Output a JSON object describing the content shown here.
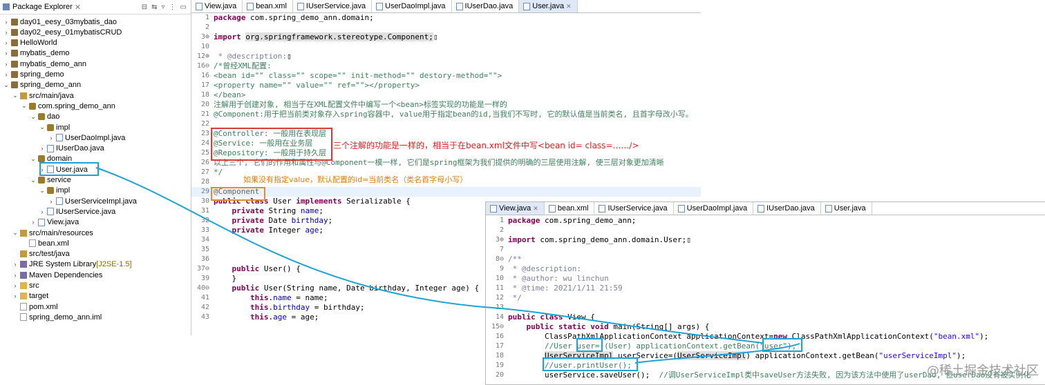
{
  "explorer": {
    "title": "Package Explorer",
    "items": [
      {
        "label": "day01_eesy_03mybatis_dao",
        "depth": 0,
        "arrow": "›",
        "icon": "proj"
      },
      {
        "label": "day02_eesy_01mybatisCRUD",
        "depth": 0,
        "arrow": "›",
        "icon": "proj"
      },
      {
        "label": "HelloWorld",
        "depth": 0,
        "arrow": "›",
        "icon": "proj"
      },
      {
        "label": "mybatis_demo",
        "depth": 0,
        "arrow": "›",
        "icon": "proj"
      },
      {
        "label": "mybatis_demo_ann",
        "depth": 0,
        "arrow": "›",
        "icon": "proj"
      },
      {
        "label": "spring_demo",
        "depth": 0,
        "arrow": "›",
        "icon": "proj"
      },
      {
        "label": "spring_demo_ann",
        "depth": 0,
        "arrow": "⌄",
        "icon": "proj"
      },
      {
        "label": "src/main/java",
        "depth": 1,
        "arrow": "⌄",
        "icon": "src"
      },
      {
        "label": "com.spring_demo_ann",
        "depth": 2,
        "arrow": "⌄",
        "icon": "pkg"
      },
      {
        "label": "dao",
        "depth": 3,
        "arrow": "⌄",
        "icon": "pkg"
      },
      {
        "label": "impl",
        "depth": 4,
        "arrow": "⌄",
        "icon": "pkg"
      },
      {
        "label": "UserDaoImpl.java",
        "depth": 5,
        "arrow": "›",
        "icon": "java"
      },
      {
        "label": "IUserDao.java",
        "depth": 4,
        "arrow": "›",
        "icon": "java"
      },
      {
        "label": "domain",
        "depth": 3,
        "arrow": "⌄",
        "icon": "pkg"
      },
      {
        "label": "User.java",
        "depth": 4,
        "arrow": "›",
        "icon": "java"
      },
      {
        "label": "service",
        "depth": 3,
        "arrow": "⌄",
        "icon": "pkg"
      },
      {
        "label": "impl",
        "depth": 4,
        "arrow": "⌄",
        "icon": "pkg"
      },
      {
        "label": "UserServiceImpl.java",
        "depth": 5,
        "arrow": "›",
        "icon": "java"
      },
      {
        "label": "IUserService.java",
        "depth": 4,
        "arrow": "›",
        "icon": "java"
      },
      {
        "label": "View.java",
        "depth": 3,
        "arrow": "›",
        "icon": "java"
      },
      {
        "label": "src/main/resources",
        "depth": 1,
        "arrow": "⌄",
        "icon": "src"
      },
      {
        "label": "bean.xml",
        "depth": 2,
        "arrow": "",
        "icon": "xml"
      },
      {
        "label": "src/test/java",
        "depth": 1,
        "arrow": "",
        "icon": "src"
      },
      {
        "label": "JRE System Library",
        "badge": "[J2SE-1.5]",
        "depth": 1,
        "arrow": "›",
        "icon": "lib"
      },
      {
        "label": "Maven Dependencies",
        "depth": 1,
        "arrow": "›",
        "icon": "lib"
      },
      {
        "label": "src",
        "depth": 1,
        "arrow": "›",
        "icon": "folder"
      },
      {
        "label": "target",
        "depth": 1,
        "arrow": "›",
        "icon": "folder"
      },
      {
        "label": "pom.xml",
        "depth": 1,
        "arrow": "",
        "icon": "xml"
      },
      {
        "label": "spring_demo_ann.iml",
        "depth": 1,
        "arrow": "",
        "icon": "xml"
      }
    ]
  },
  "editor1": {
    "tabs": [
      "View.java",
      "bean.xml",
      "IUserService.java",
      "UserDaoImpl.java",
      "IUserDao.java",
      "User.java"
    ],
    "active_tab": "User.java",
    "lines": [
      {
        "n": "1",
        "html": "<span class=\"kw\">package</span> com.spring_demo_ann.domain;"
      },
      {
        "n": "2",
        "html": ""
      },
      {
        "n": "3⊕",
        "html": "<span class=\"kw\">import</span> <span style=\"background:#e0e0e0\">org.springframework.stereotype.Component;</span>▯"
      },
      {
        "n": "10",
        "html": ""
      },
      {
        "n": "12⊕",
        "html": "<span class=\"ja\"> * @description:</span>▯"
      },
      {
        "n": "16⊖",
        "html": "<span class=\"cm\">/*曾经XML配置:</span>"
      },
      {
        "n": "16",
        "html": "<span class=\"cm\">&lt;bean id=\"\" class=\"\" scope=\"\" init-method=\"\" destory-method=\"\"&gt;</span>"
      },
      {
        "n": "17",
        "html": "<span class=\"cm\">&lt;property name=\"\" value=\"\" ref=\"\"&gt;&lt;/property&gt;</span>"
      },
      {
        "n": "18",
        "html": "<span class=\"cm\">&lt;/bean&gt;</span>"
      },
      {
        "n": "20",
        "html": "<span class=\"cm\">注解用于创建对象, 相当于在XML配置文件中编写一个&lt;bean&gt;标签实现的功能是一样的</span>"
      },
      {
        "n": "21",
        "html": "<span class=\"cm\">@Component:用于把当前类对象存入spring容器中, value用于指定bean的id,当我们不写时, 它的默认值是当前类名, 且首字母改小写。</span>"
      },
      {
        "n": "22",
        "html": ""
      },
      {
        "n": "23",
        "html": "<span class=\"cm\">@Controller: 一般用在表现层</span>"
      },
      {
        "n": "24",
        "html": "<span class=\"cm\">@Service: 一般用在业务层</span>"
      },
      {
        "n": "25",
        "html": "<span class=\"cm\">@Repository: 一般用于持久层</span>"
      },
      {
        "n": "26",
        "html": "<span class=\"cm\">以上三个, 它们的作用和属性与@Component一模一样, 它们是spring框架为我们提供的明确的三层使用注解, 使三层对象更加清晰</span>"
      },
      {
        "n": "27",
        "html": "<span class=\"cm\">*/</span>"
      },
      {
        "n": "28",
        "html": ""
      },
      {
        "n": "29",
        "html": "<span class=\"ann\">@Component</span>"
      },
      {
        "n": "30",
        "html": "<span class=\"kw\">public class</span> User <span class=\"kw\">implements</span> Serializable {"
      },
      {
        "n": "31",
        "html": "    <span class=\"kw\">private</span> String <span class=\"fld\">name</span>;"
      },
      {
        "n": "32",
        "html": "    <span class=\"kw\">private</span> Date <span class=\"fld\">birthday</span>;"
      },
      {
        "n": "33",
        "html": "    <span class=\"kw\">private</span> Integer <span class=\"fld\">age</span>;"
      },
      {
        "n": "34",
        "html": ""
      },
      {
        "n": "35",
        "html": ""
      },
      {
        "n": "36",
        "html": ""
      },
      {
        "n": "37⊖",
        "html": "    <span class=\"kw\">public</span> User() {"
      },
      {
        "n": "39",
        "html": "    }"
      },
      {
        "n": "40⊖",
        "html": "    <span class=\"kw\">public</span> User(String name, Date birthday, Integer age) {"
      },
      {
        "n": "41",
        "html": "        <span class=\"kw\">this</span>.<span class=\"fld\">name</span> = name;"
      },
      {
        "n": "42",
        "html": "        <span class=\"kw\">this</span>.<span class=\"fld\">birthday</span> = birthday;"
      },
      {
        "n": "43",
        "html": "        <span class=\"kw\">this</span>.<span class=\"fld\">age</span> = age;"
      }
    ]
  },
  "editor2": {
    "tabs": [
      "View.java",
      "bean.xml",
      "IUserService.java",
      "UserDaoImpl.java",
      "IUserDao.java",
      "User.java"
    ],
    "active_tab": "View.java",
    "lines": [
      {
        "n": "1",
        "html": "<span class=\"kw\">package</span> com.spring_demo_ann;"
      },
      {
        "n": "2",
        "html": ""
      },
      {
        "n": "3⊕",
        "html": "<span class=\"kw\">import</span> com.spring_demo_ann.domain.User;▯"
      },
      {
        "n": "7",
        "html": ""
      },
      {
        "n": "8⊖",
        "html": "<span class=\"ja\">/**</span>"
      },
      {
        "n": "9",
        "html": "<span class=\"ja\"> * @description:</span>"
      },
      {
        "n": "10",
        "html": "<span class=\"ja\"> * @author: wu linchun</span>"
      },
      {
        "n": "11",
        "html": "<span class=\"ja\"> * @time: 2021/1/11 21:59</span>"
      },
      {
        "n": "12",
        "html": "<span class=\"ja\"> */</span>"
      },
      {
        "n": "13",
        "html": ""
      },
      {
        "n": "14",
        "html": "<span class=\"kw\">public class</span> View {"
      },
      {
        "n": "15⊖",
        "html": "    <span class=\"kw\">public static void</span> main(String[] args) {"
      },
      {
        "n": "16",
        "html": "        ClassPathXmlApplicationContext applicationContext=<span class=\"kw\">new</span> ClassPathXmlApplicationContext(<span class=\"st\">\"bean.xml\"</span>);"
      },
      {
        "n": "17",
        "html": "        <span class=\"cm\">//User user= (User) applicationContext.getBean(\"user\");</span>"
      },
      {
        "n": "18",
        "html": "        <span style=\"background:#e0e0e0\">UserServiceImpl</span> userService=(<span style=\"background:#e0e0e0\">UserServiceImpl</span>) applicationContext.getBean(<span class=\"st\">\"userServiceImpl\"</span>);"
      },
      {
        "n": "19",
        "html": "        <span class=\"cm\">//user.printUser();</span>"
      },
      {
        "n": "20",
        "html": "        userService.saveUser();  <span class=\"cm\">//调UserServiceImpl类中saveUser方法失败, 因为该方法中使用了userDao, 但userDao没有被实例化</span>"
      }
    ]
  },
  "annotations": {
    "red_note": "三个注解的功能是一样的，相当于在bean.xml文件中写<bean id= class=……/>",
    "orange_note": "如果没有指定value，默认配置的id=当前类名（类名首字母小写）"
  },
  "watermark": "@稀土掘金技术社区",
  "colors": {
    "keyword": "#7f0055",
    "comment": "#3f7f5f",
    "string": "#2a00ff",
    "box_red": "#d93a3a",
    "box_blue": "#1aa3d8",
    "box_orange": "#e78b2a"
  }
}
